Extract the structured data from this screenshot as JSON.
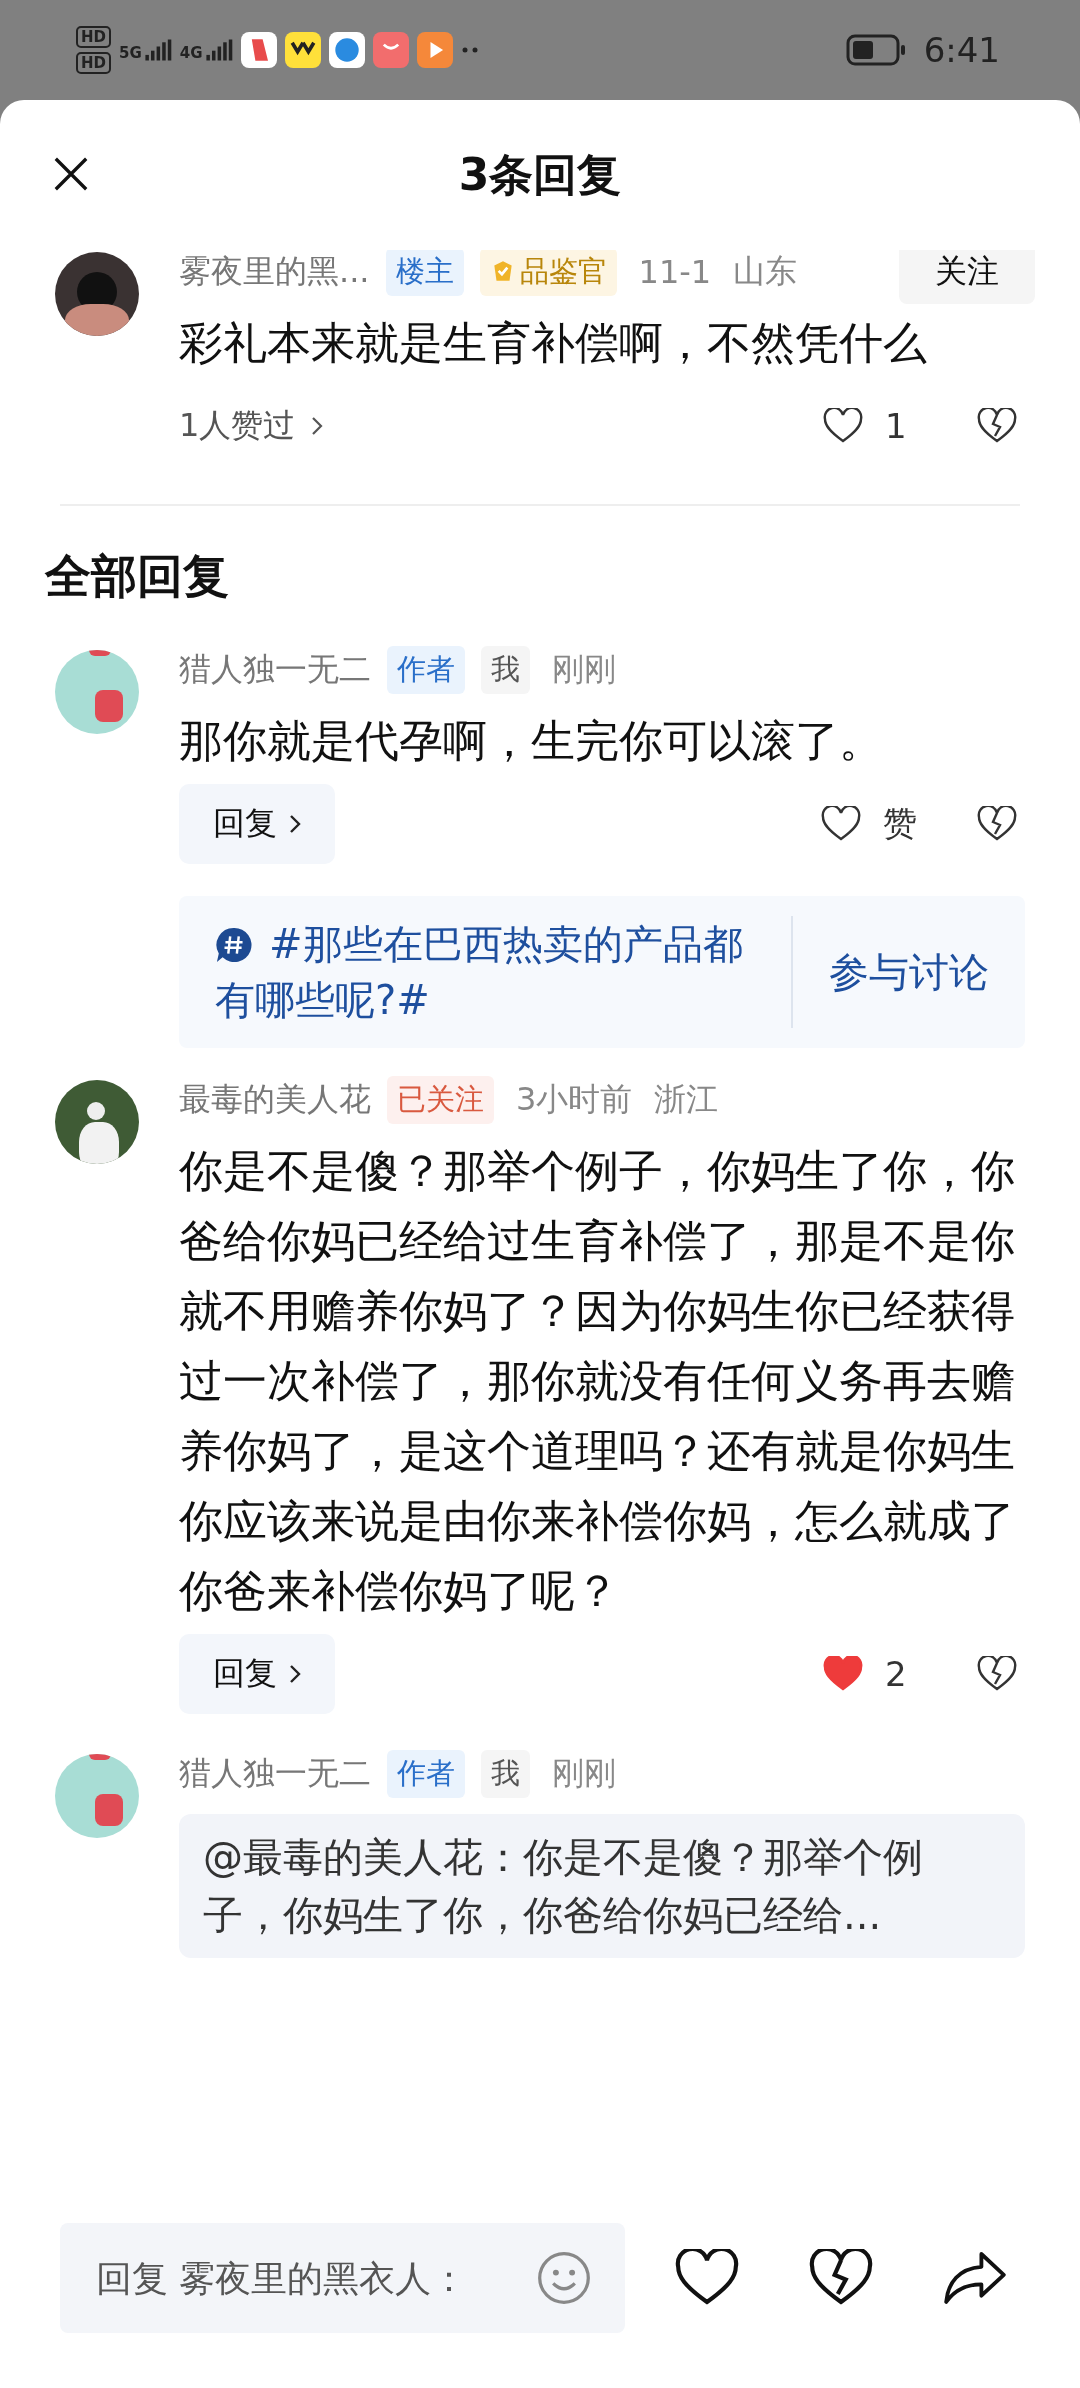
{
  "status_bar": {
    "sim_labels": [
      "HD",
      "HD"
    ],
    "networks": [
      "5G",
      "4G"
    ],
    "time": "6:41"
  },
  "header": {
    "title": "3条回复"
  },
  "main_comment": {
    "avatar": {
      "kind": "dark"
    },
    "author": "雾夜里的黑...",
    "badges": [
      {
        "kind": "op",
        "label": "楼主"
      },
      {
        "kind": "expert",
        "label": "品鉴官"
      }
    ],
    "time": "11-1",
    "location": "山东",
    "follow_button": "关注",
    "text": "彩礼本来就是生育补偿啊，不然凭什么",
    "liked_by": "1人赞过",
    "liked": false,
    "like_label": "1"
  },
  "section_title": "全部回复",
  "replies": [
    {
      "avatar": {
        "kind": "sticker"
      },
      "author": "猎人独一无二",
      "badges": [
        {
          "kind": "author",
          "label": "作者"
        },
        {
          "kind": "me",
          "label": "我"
        }
      ],
      "time": "刚刚",
      "text": "那你就是代孕啊，生完你可以滚了。",
      "reply_button": "回复",
      "liked": false,
      "like_label": "赞",
      "topic": {
        "text": "#那些在巴西热卖的产品都有哪些呢?#",
        "action": "参与讨论"
      }
    },
    {
      "avatar": {
        "kind": "flower"
      },
      "author": "最毒的美人花",
      "badges": [
        {
          "kind": "following",
          "label": "已关注"
        }
      ],
      "time": "3小时前",
      "location": "浙江",
      "text": "你是不是傻？那举个例子，你妈生了你，你爸给你妈已经给过生育补偿了，那是不是你就不用赡养你妈了？因为你妈生你已经获得过一次补偿了，那你就没有任何义务再去赡养你妈了，是这个道理吗？还有就是你妈生你应该来说是由你来补偿你妈，怎么就成了你爸来补偿你妈了呢？",
      "reply_button": "回复",
      "liked": true,
      "like_label": "2"
    },
    {
      "avatar": {
        "kind": "sticker"
      },
      "author": "猎人独一无二",
      "badges": [
        {
          "kind": "author",
          "label": "作者"
        },
        {
          "kind": "me",
          "label": "我"
        }
      ],
      "time": "刚刚",
      "quote": "@最毒的美人花：你是不是傻？那举个例子，你妈生了你，你爸给你妈已经给..."
    }
  ],
  "reply_bar": {
    "placeholder": "回复 雾夜里的黑衣人："
  }
}
